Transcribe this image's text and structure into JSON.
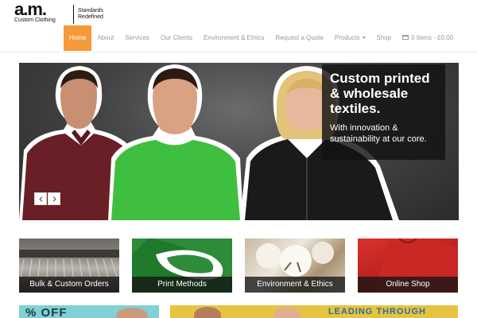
{
  "brand": {
    "mark": "a.m.",
    "subtitle": "Custom Clothing",
    "tagline": "Standards\nRedefined"
  },
  "nav": {
    "items": [
      {
        "label": "Home",
        "active": true
      },
      {
        "label": "About"
      },
      {
        "label": "Services"
      },
      {
        "label": "Our Clients"
      },
      {
        "label": "Environment & Ethics"
      },
      {
        "label": "Request a Quote"
      },
      {
        "label": "Products"
      },
      {
        "label": "Shop"
      }
    ],
    "cart": "0 items - £0.00"
  },
  "hero": {
    "title": "Custom printed & wholesale textiles.",
    "subtitle": "With innovation & sustainability at our core."
  },
  "tiles": [
    {
      "label": "Bulk & Custom Orders"
    },
    {
      "label": "Print Methods"
    },
    {
      "label": "Environment & Ethics"
    },
    {
      "label": "Online Shop"
    }
  ],
  "promos": {
    "left_text": "% OFF",
    "right_text": "LEADING THROUGH"
  },
  "colors": {
    "accent": "#f5993b",
    "nav_text": "#9a9a9a"
  }
}
